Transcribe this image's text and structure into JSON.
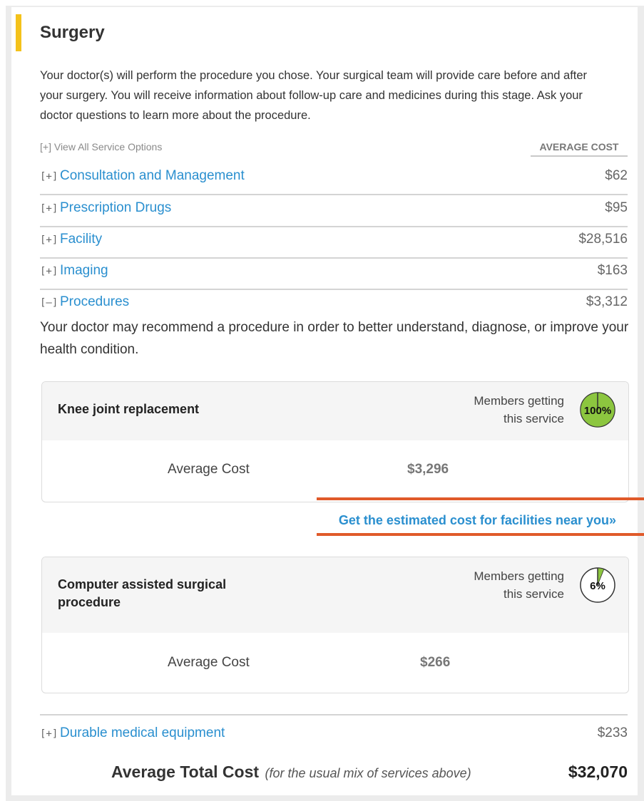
{
  "section": {
    "title": "Surgery",
    "intro": "Your doctor(s) will perform the procedure you chose. Your surgical team will provide care before and after your surgery. You will receive information about follow-up care and medicines during this stage. Ask your doctor questions to learn more about the procedure."
  },
  "view_all": {
    "toggle": "[+]",
    "label": "View All Service Options"
  },
  "avg_cost_header": "AVERAGE COST",
  "services": [
    {
      "toggle": "[+]",
      "label": "Consultation and Management",
      "cost": "$62"
    },
    {
      "toggle": "[+]",
      "label": "Prescription Drugs",
      "cost": "$95"
    },
    {
      "toggle": "[+]",
      "label": "Facility",
      "cost": "$28,516"
    },
    {
      "toggle": "[+]",
      "label": "Imaging",
      "cost": "$163"
    },
    {
      "toggle": "[–]",
      "label": "Procedures",
      "cost": "$3,312"
    }
  ],
  "procedures_description": "Your doctor may recommend a procedure in order to better understand, diagnose, or improve your health condition.",
  "procedure_cards": [
    {
      "title": "Knee joint replacement",
      "members_line1": "Members getting",
      "members_line2": "this service",
      "percent": "100%",
      "percent_value": 100,
      "avg_label": "Average Cost",
      "avg_value": "$3,296"
    },
    {
      "title_line1": "Computer assisted surgical",
      "title_line2": "procedure",
      "members_line1": "Members getting",
      "members_line2": "this service",
      "percent": "6%",
      "percent_value": 6,
      "avg_label": "Average Cost",
      "avg_value": "$266"
    }
  ],
  "estimate_link": "Get the estimated cost for facilities near you»",
  "durable": {
    "toggle": "[+]",
    "label": "Durable medical equipment",
    "cost": "$233"
  },
  "total": {
    "label": "Average Total Cost",
    "note": "(for the usual mix of services above)",
    "value": "$32,070"
  },
  "colors": {
    "accent": "#f4c21b",
    "link": "#2a8fcf",
    "badge_green": "#8cc63f",
    "highlight": "#e05a2a"
  }
}
